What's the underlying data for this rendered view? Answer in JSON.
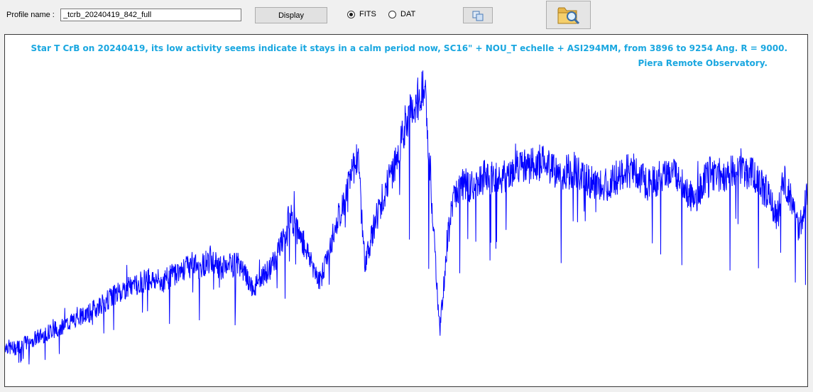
{
  "toolbar": {
    "profile_label": "Profile name :",
    "profile_value": "_tcrb_20240419_842_full",
    "display_label": "Display",
    "radio_fits_label": "FITS",
    "radio_dat_label": "DAT",
    "selected_format": "FITS",
    "copy_icon": "copy-icon",
    "open_icon": "folder-search-icon"
  },
  "plot": {
    "line_color": "#0000ff",
    "annotation_color": "#1aa7e0",
    "annotation_line1": "Star T CrB on 20240419, its low activity seems indicate it stays in a calm period now, SC16\" + NOU_T echelle + ASI294MM,  from 3896 to 9254 Ang. R = 9000.",
    "annotation_line2": "Piera Remote Observatory."
  },
  "chart_data": {
    "type": "line",
    "title": "Star T CrB on 20240419, its low activity seems indicate it stays in a calm period now, SC16\" + NOU_T echelle + ASI294MM,  from 3896 to 9254 Ang. R = 9000.",
    "subtitle": "Piera Remote Observatory.",
    "xlabel": "",
    "ylabel": "",
    "xlim": [
      3896,
      9254
    ],
    "ylim": [
      0,
      1
    ],
    "grid": false,
    "series": [
      {
        "x": [
          3896,
          3950,
          4050,
          4150,
          4250,
          4350,
          4450,
          4550,
          4650,
          4750,
          4850,
          4950,
          5050,
          5150,
          5200,
          5250,
          5350,
          5450,
          5550,
          5600,
          5650,
          5700,
          5750,
          5800,
          5900,
          6000,
          6050,
          6100,
          6150,
          6200,
          6250,
          6300,
          6400,
          6500,
          6550,
          6600,
          6650,
          6700,
          6800,
          6850,
          6900,
          6950,
          7000,
          7100,
          7200,
          7300,
          7400,
          7500,
          7600,
          7700,
          7800,
          7900,
          8000,
          8100,
          8200,
          8300,
          8400,
          8500,
          8550,
          8600,
          8700,
          8800,
          8900,
          8950,
          9000,
          9050,
          9100,
          9150,
          9200,
          9254
        ],
        "y": [
          0.12,
          0.11,
          0.13,
          0.15,
          0.17,
          0.19,
          0.21,
          0.24,
          0.27,
          0.29,
          0.31,
          0.3,
          0.33,
          0.35,
          0.34,
          0.36,
          0.34,
          0.35,
          0.28,
          0.3,
          0.33,
          0.36,
          0.42,
          0.49,
          0.4,
          0.3,
          0.38,
          0.45,
          0.52,
          0.58,
          0.67,
          0.35,
          0.52,
          0.63,
          0.72,
          0.78,
          0.82,
          0.84,
          0.16,
          0.42,
          0.55,
          0.58,
          0.57,
          0.6,
          0.59,
          0.62,
          0.63,
          0.64,
          0.6,
          0.62,
          0.58,
          0.57,
          0.6,
          0.62,
          0.57,
          0.61,
          0.6,
          0.52,
          0.58,
          0.61,
          0.6,
          0.63,
          0.6,
          0.57,
          0.55,
          0.47,
          0.6,
          0.52,
          0.45,
          0.55
        ]
      }
    ]
  }
}
